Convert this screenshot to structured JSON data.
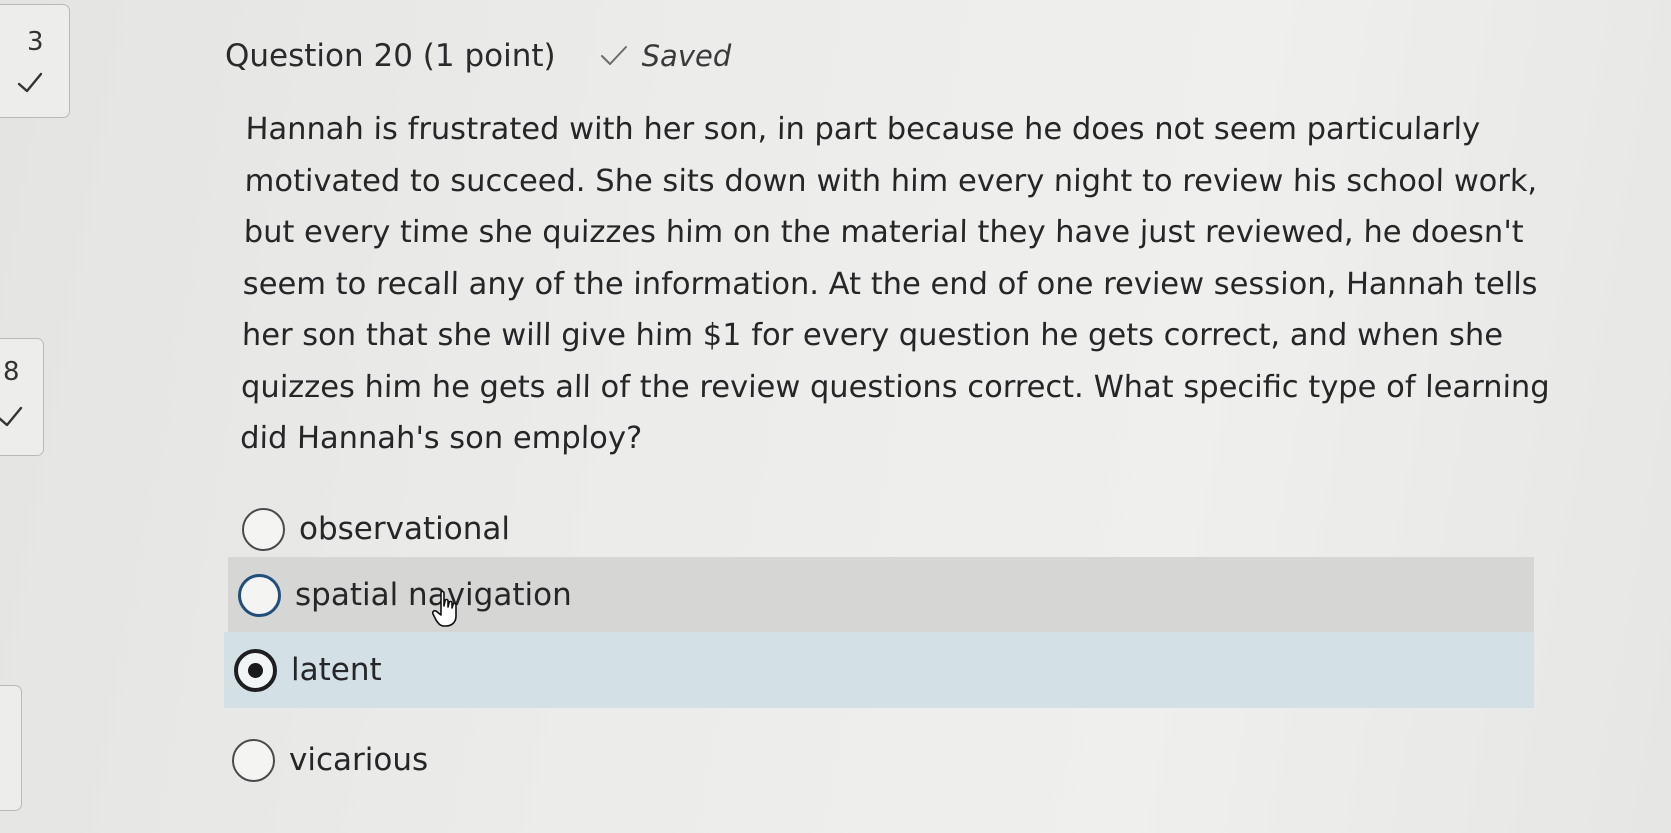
{
  "sidebar": {
    "tiles": [
      {
        "number": "3",
        "status_icon": "checkmark-icon"
      },
      {
        "number": "8",
        "status_icon": "checkmark-icon"
      },
      {
        "number": "",
        "status_icon": ""
      }
    ]
  },
  "question": {
    "title": "Question 20 (1 point)",
    "save_status": "Saved",
    "text": "Hannah is frustrated with her son, in part because he does not seem particularly motivated to succeed. She sits down with him every night to review his school work, but every time she quizzes him on the material they have just reviewed, he doesn't seem to recall any of the information. At the end of one review session, Hannah tells her son that she will give him $1 for every question he gets correct, and when she quizzes him he gets all of the review questions correct. What specific type of learning did Hannah's son employ?"
  },
  "answers": [
    {
      "label": "observational",
      "selected": false
    },
    {
      "label": "spatial navigation",
      "selected": false,
      "hovered": true
    },
    {
      "label": "latent",
      "selected": true
    },
    {
      "label": "vicarious",
      "selected": false
    }
  ],
  "colors": {
    "hover_row": "#d6d6d4",
    "selected_row": "#d3e0e6",
    "focus_ring": "#1f4f7a"
  }
}
